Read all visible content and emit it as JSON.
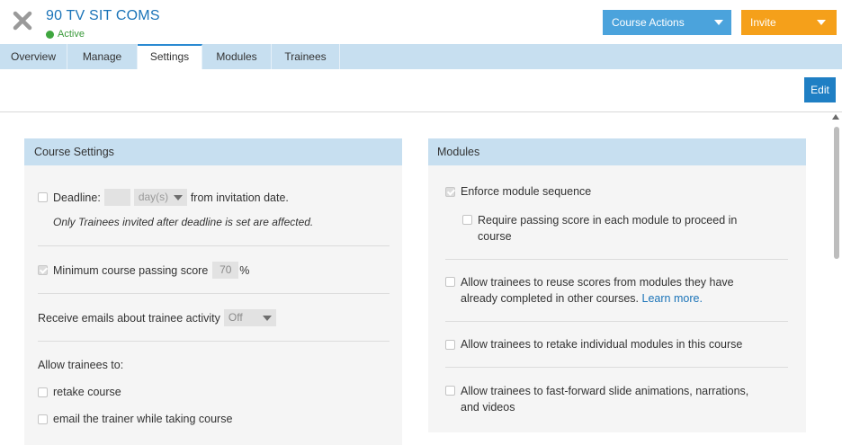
{
  "header": {
    "title": "90 TV SIT COMS",
    "status": "Active",
    "course_actions_label": "Course Actions",
    "invite_label": "Invite"
  },
  "tabs": [
    {
      "label": "Overview"
    },
    {
      "label": "Manage"
    },
    {
      "label": "Settings"
    },
    {
      "label": "Modules"
    },
    {
      "label": "Trainees"
    }
  ],
  "active_tab": "Settings",
  "toolbar": {
    "edit_label": "Edit"
  },
  "course_settings": {
    "heading": "Course Settings",
    "deadline": {
      "label": "Deadline:",
      "value": "",
      "unit": "day(s)",
      "suffix": "from invitation date.",
      "checked": false,
      "note": "Only Trainees invited after deadline is set are affected."
    },
    "passing_score": {
      "label": "Minimum course passing score",
      "value": "70",
      "unit": "%",
      "checked": true
    },
    "emails": {
      "label": "Receive emails about trainee activity",
      "value": "Off"
    },
    "allow": {
      "label": "Allow trainees to:",
      "options": [
        {
          "label": "retake course",
          "checked": false
        },
        {
          "label": "email the trainer while taking course",
          "checked": false
        }
      ]
    }
  },
  "modules": {
    "heading": "Modules",
    "enforce_sequence": {
      "label": "Enforce module sequence",
      "checked": true
    },
    "require_passing": {
      "line1": "Require passing score in each module to proceed in",
      "line2": "course",
      "checked": false
    },
    "reuse_scores": {
      "line1": "Allow trainees to reuse scores from modules they have",
      "line2": "already completed in other courses.",
      "link": "Learn more.",
      "checked": false
    },
    "retake_modules": {
      "label": "Allow trainees to retake individual modules in this course",
      "checked": false
    },
    "fast_forward": {
      "line1": "Allow trainees to fast-forward slide animations, narrations,",
      "line2": "and videos",
      "checked": false
    }
  },
  "colors": {
    "brand_blue": "#1a73b8",
    "tab_bar": "#c7dff0",
    "course_actions": "#4ba3dc",
    "invite": "#f5a01a",
    "active_green": "#3fa63f"
  },
  "icons": [
    "close-icon",
    "status-dot-icon",
    "chevron-down-icon",
    "checkbox-icon",
    "scroll-up-arrow-icon"
  ]
}
